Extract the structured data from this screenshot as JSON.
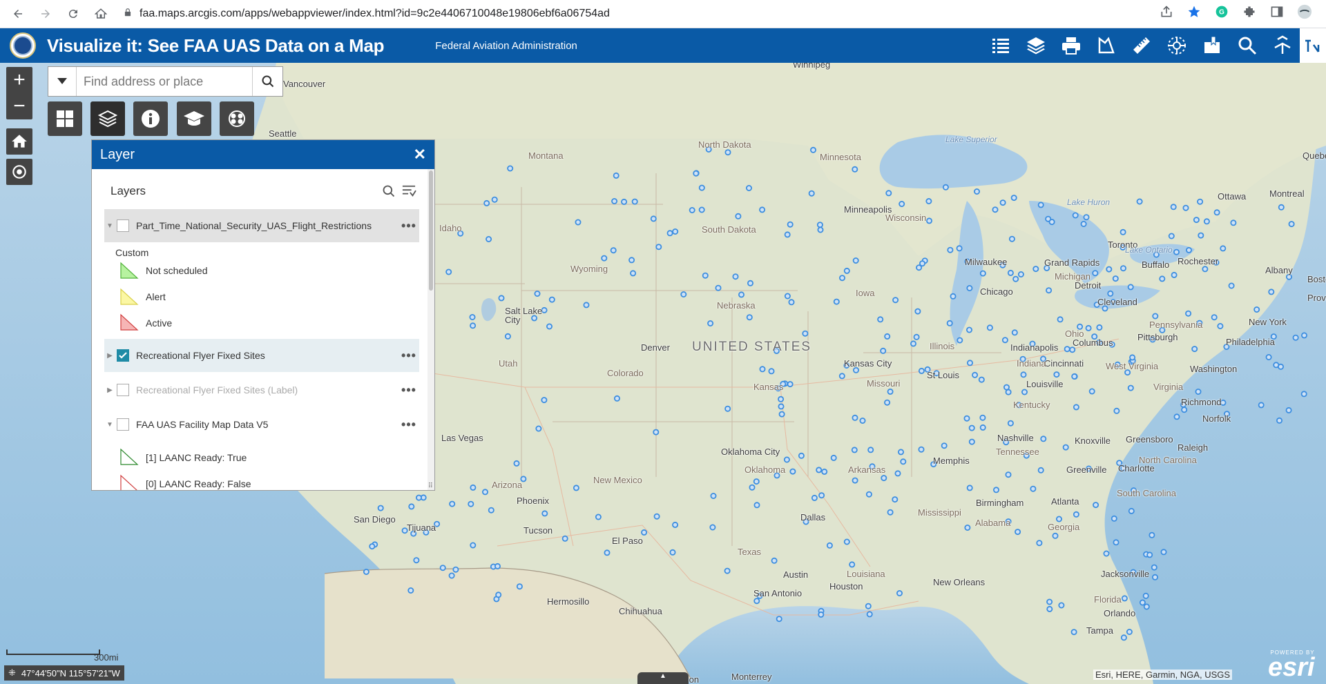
{
  "browser": {
    "url": "faa.maps.arcgis.com/apps/webappviewer/index.html?id=9c2e4406710048e19806ebf6a06754ad"
  },
  "header": {
    "title": "Visualize it: See FAA UAS Data on a Map",
    "subtitle": "Federal Aviation Administration",
    "tools": [
      "legend-icon",
      "layers-icon",
      "print-icon",
      "measure-area-icon",
      "ruler-icon",
      "drone-icon",
      "bookmark-icon",
      "query-icon",
      "share-icon",
      "accessibility-icon"
    ]
  },
  "search": {
    "placeholder": "Find address or place"
  },
  "layer_panel": {
    "title": "Layer",
    "heading": "Layers",
    "layers": [
      {
        "label": "Part_Time_National_Security_UAS_Flight_Restrictions",
        "checked": false,
        "expanded": true
      },
      {
        "label": "Recreational Flyer Fixed Sites",
        "checked": true,
        "expanded": false
      },
      {
        "label": "Recreational Flyer Fixed Sites (Label)",
        "checked": false,
        "expanded": false
      },
      {
        "label": "FAA UAS Facility Map Data V5",
        "checked": false,
        "expanded": true
      }
    ],
    "legend1": {
      "group": "Custom",
      "items": [
        {
          "label": "Not scheduled",
          "color": "#b7f2a0",
          "stroke": "#52b23a"
        },
        {
          "label": "Alert",
          "color": "#fbf7a4",
          "stroke": "#d9d04a"
        },
        {
          "label": "Active",
          "color": "#f6b5b5",
          "stroke": "#d14040"
        }
      ]
    },
    "legend2": {
      "items": [
        {
          "label": "[1] LAANC Ready: True",
          "color": "#ffffff",
          "stroke": "#2f8a2f"
        },
        {
          "label": "[0] LAANC Ready: False",
          "color": "#ffffff",
          "stroke": "#d14040"
        }
      ]
    }
  },
  "map": {
    "labels": {
      "country": "UNITED STATES",
      "cities": [
        "Winnipeg",
        "Vancouver",
        "Seattle",
        "Minneapolis",
        "Milwaukee",
        "Chicago",
        "Detroit",
        "Toronto",
        "Ottawa",
        "Montreal",
        "Grand Rapids",
        "Buffalo",
        "Rochester",
        "Albany",
        "Boston",
        "Providence",
        "Cleveland",
        "New York",
        "Philadelphia",
        "Pittsburgh",
        "Columbus",
        "Indianapolis",
        "Cincinnati",
        "Washington",
        "Salt Lake City",
        "Denver",
        "Kansas City",
        "St Louis",
        "Louisville",
        "Richmond",
        "Norfolk",
        "Nashville",
        "Knoxville",
        "Greensboro",
        "Raleigh",
        "Charlotte",
        "Las Vegas",
        "Oklahoma City",
        "Memphis",
        "Greenville",
        "Atlanta",
        "Birmingham",
        "Phoenix",
        "San Diego",
        "Tijuana",
        "Tucson",
        "El Paso",
        "Dallas",
        "Austin",
        "Houston",
        "San Antonio",
        "New Orleans",
        "Jacksonville",
        "Orlando",
        "Tampa",
        "Hermosillo",
        "Chihuahua",
        "Monterrey",
        "Torreon",
        "Quebec"
      ],
      "states": [
        "North Dakota",
        "Montana",
        "Minnesota",
        "South Dakota",
        "Wisconsin",
        "Michigan",
        "Wyoming",
        "Idaho",
        "Nebraska",
        "Iowa",
        "Illinois",
        "Indiana",
        "Ohio",
        "Pennsylvania",
        "Utah",
        "Colorado",
        "Kansas",
        "Missouri",
        "Kentucky",
        "West Virginia",
        "Virginia",
        "Tennessee",
        "North Carolina",
        "South Carolina",
        "Arizona",
        "New Mexico",
        "Oklahoma",
        "Arkansas",
        "Mississippi",
        "Alabama",
        "Georgia",
        "Texas",
        "Louisiana",
        "Florida"
      ],
      "water": [
        "Lake Superior",
        "Lake Huron",
        "Lake Ontario"
      ]
    },
    "scale_label": "300mi",
    "coordinates": "47°44'50\"N 115°57'21\"W",
    "attribution": "Esri, HERE, Garmin, NGA, USGS",
    "powered_by": "POWERED BY",
    "esri_logo": "esri"
  },
  "colors": {
    "brand_blue": "#0a5aa6",
    "site_dot": "#3b8de0",
    "checkbox_on": "#1f8ba6"
  }
}
